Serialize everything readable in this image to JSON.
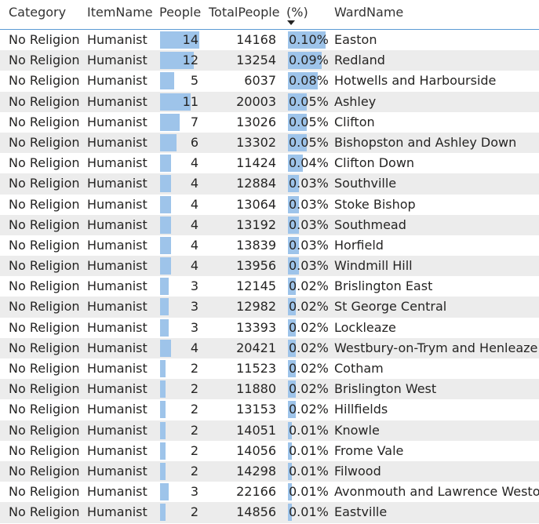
{
  "columns": {
    "category": "Category",
    "item_name": "ItemName",
    "people": "People",
    "total_people": "TotalPeople",
    "pct": "(%)",
    "ward_name": "WardName"
  },
  "sort": {
    "column": "pct",
    "direction": "descending"
  },
  "colors": {
    "bar": "#9ec4ea",
    "header_rule": "#5b9bd5",
    "alt_row": "#ececec"
  },
  "bar_max": {
    "people": 14,
    "pct": 0.1
  },
  "rows": [
    {
      "category": "No Religion",
      "item_name": "Humanist",
      "people": "14",
      "total_people": "14168",
      "pct": "0.10%",
      "ward_name": "Easton"
    },
    {
      "category": "No Religion",
      "item_name": "Humanist",
      "people": "12",
      "total_people": "13254",
      "pct": "0.09%",
      "ward_name": "Redland"
    },
    {
      "category": "No Religion",
      "item_name": "Humanist",
      "people": "5",
      "total_people": "6037",
      "pct": "0.08%",
      "ward_name": "Hotwells and Harbourside"
    },
    {
      "category": "No Religion",
      "item_name": "Humanist",
      "people": "11",
      "total_people": "20003",
      "pct": "0.05%",
      "ward_name": "Ashley"
    },
    {
      "category": "No Religion",
      "item_name": "Humanist",
      "people": "7",
      "total_people": "13026",
      "pct": "0.05%",
      "ward_name": "Clifton"
    },
    {
      "category": "No Religion",
      "item_name": "Humanist",
      "people": "6",
      "total_people": "13302",
      "pct": "0.05%",
      "ward_name": "Bishopston and Ashley Down"
    },
    {
      "category": "No Religion",
      "item_name": "Humanist",
      "people": "4",
      "total_people": "11424",
      "pct": "0.04%",
      "ward_name": "Clifton Down"
    },
    {
      "category": "No Religion",
      "item_name": "Humanist",
      "people": "4",
      "total_people": "12884",
      "pct": "0.03%",
      "ward_name": "Southville"
    },
    {
      "category": "No Religion",
      "item_name": "Humanist",
      "people": "4",
      "total_people": "13064",
      "pct": "0.03%",
      "ward_name": "Stoke Bishop"
    },
    {
      "category": "No Religion",
      "item_name": "Humanist",
      "people": "4",
      "total_people": "13192",
      "pct": "0.03%",
      "ward_name": "Southmead"
    },
    {
      "category": "No Religion",
      "item_name": "Humanist",
      "people": "4",
      "total_people": "13839",
      "pct": "0.03%",
      "ward_name": "Horfield"
    },
    {
      "category": "No Religion",
      "item_name": "Humanist",
      "people": "4",
      "total_people": "13956",
      "pct": "0.03%",
      "ward_name": "Windmill Hill"
    },
    {
      "category": "No Religion",
      "item_name": "Humanist",
      "people": "3",
      "total_people": "12145",
      "pct": "0.02%",
      "ward_name": "Brislington East"
    },
    {
      "category": "No Religion",
      "item_name": "Humanist",
      "people": "3",
      "total_people": "12982",
      "pct": "0.02%",
      "ward_name": "St George Central"
    },
    {
      "category": "No Religion",
      "item_name": "Humanist",
      "people": "3",
      "total_people": "13393",
      "pct": "0.02%",
      "ward_name": "Lockleaze"
    },
    {
      "category": "No Religion",
      "item_name": "Humanist",
      "people": "4",
      "total_people": "20421",
      "pct": "0.02%",
      "ward_name": "Westbury-on-Trym and Henleaze"
    },
    {
      "category": "No Religion",
      "item_name": "Humanist",
      "people": "2",
      "total_people": "11523",
      "pct": "0.02%",
      "ward_name": "Cotham"
    },
    {
      "category": "No Religion",
      "item_name": "Humanist",
      "people": "2",
      "total_people": "11880",
      "pct": "0.02%",
      "ward_name": "Brislington West"
    },
    {
      "category": "No Religion",
      "item_name": "Humanist",
      "people": "2",
      "total_people": "13153",
      "pct": "0.02%",
      "ward_name": "Hillfields"
    },
    {
      "category": "No Religion",
      "item_name": "Humanist",
      "people": "2",
      "total_people": "14051",
      "pct": "0.01%",
      "ward_name": "Knowle"
    },
    {
      "category": "No Religion",
      "item_name": "Humanist",
      "people": "2",
      "total_people": "14056",
      "pct": "0.01%",
      "ward_name": "Frome Vale"
    },
    {
      "category": "No Religion",
      "item_name": "Humanist",
      "people": "2",
      "total_people": "14298",
      "pct": "0.01%",
      "ward_name": "Filwood"
    },
    {
      "category": "No Religion",
      "item_name": "Humanist",
      "people": "3",
      "total_people": "22166",
      "pct": "0.01%",
      "ward_name": "Avonmouth and Lawrence Weston"
    },
    {
      "category": "No Religion",
      "item_name": "Humanist",
      "people": "2",
      "total_people": "14856",
      "pct": "0.01%",
      "ward_name": "Eastville"
    }
  ]
}
